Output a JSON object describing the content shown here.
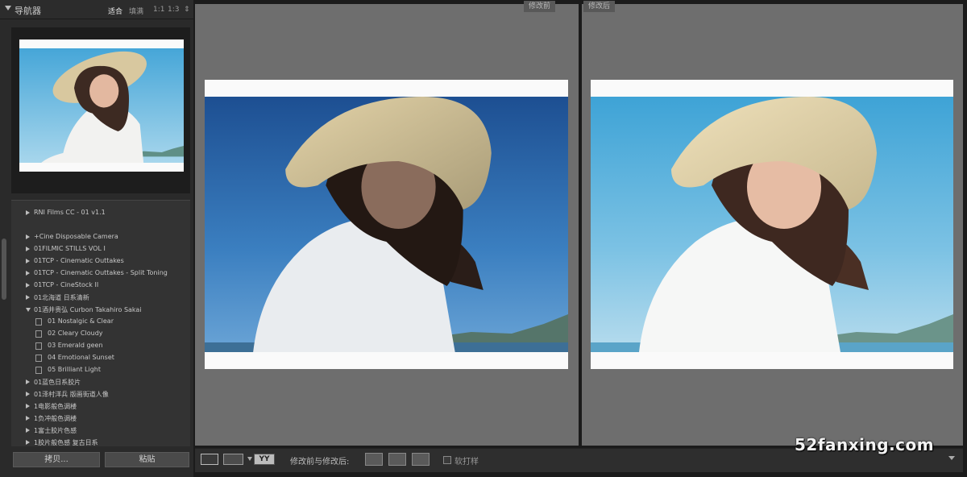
{
  "navigator": {
    "title": "导航器",
    "zoom_options": [
      "适合",
      "填满",
      "1:1",
      "1:3",
      "⇕"
    ]
  },
  "presets": {
    "items": [
      {
        "label": "RNI Films CC - 01 v1.1",
        "type": "folder",
        "expanded": false
      },
      {
        "label": "+Cine Disposable Camera",
        "type": "folder",
        "expanded": false
      },
      {
        "label": "01FILMIC STILLS VOL I",
        "type": "folder",
        "expanded": false
      },
      {
        "label": "01TCP - Cinematic Outtakes",
        "type": "folder",
        "expanded": false
      },
      {
        "label": "01TCP - Cinematic Outtakes - Split Toning",
        "type": "folder",
        "expanded": false
      },
      {
        "label": "01TCP - CineStock II",
        "type": "folder",
        "expanded": false
      },
      {
        "label": "01北海道 日系清新",
        "type": "folder",
        "expanded": false
      },
      {
        "label": "01酒井贵弘 Curbon Takahiro Sakai",
        "type": "folder",
        "expanded": true
      },
      {
        "label": "01 Nostalgic & Clear",
        "type": "preset"
      },
      {
        "label": "02 Cleary Cloudy",
        "type": "preset"
      },
      {
        "label": "03 Emerald geen",
        "type": "preset"
      },
      {
        "label": "04 Emotional Sunset",
        "type": "preset"
      },
      {
        "label": "05 Brilliant Light",
        "type": "preset"
      },
      {
        "label": "01蓝色日系胶片",
        "type": "folder",
        "expanded": false
      },
      {
        "label": "01泽村洋兵 版画街道人像",
        "type": "folder",
        "expanded": false
      },
      {
        "label": "1电影般色调楼",
        "type": "folder",
        "expanded": false
      },
      {
        "label": "1负冲般色调楼",
        "type": "folder",
        "expanded": false
      },
      {
        "label": "1富士胶片色感",
        "type": "folder",
        "expanded": false
      },
      {
        "label": "1胶片般色感 复古日系",
        "type": "folder",
        "expanded": false
      }
    ]
  },
  "buttons": {
    "copy": "拷贝...",
    "paste": "粘贴"
  },
  "view": {
    "before_label": "修改前",
    "after_label": "修改后"
  },
  "toolbar": {
    "yy_label": "YY",
    "compare_label": "修改前与修改后:",
    "softproof_label": "软打样"
  },
  "watermark": "52fanxing.com",
  "colors": {
    "background": "#1b1b1b",
    "panel": "#2a2a2a",
    "view_gray": "#6e6e6e"
  }
}
